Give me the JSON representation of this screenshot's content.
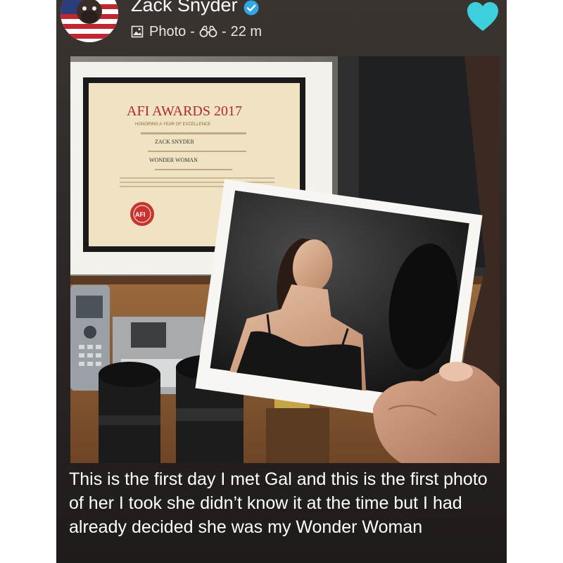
{
  "post": {
    "author": "Zack Snyder",
    "type_label": "Photo",
    "separator": "-",
    "time_ago": "22 m"
  },
  "photo": {
    "certificate_title": "AFI AWARDS 2017",
    "certificate_subtitle": "HONORING A YEAR OF EXCELLENCE",
    "certificate_name": "ZACK SNYDER",
    "certificate_film": "WONDER WOMAN",
    "seal_text": "AFI"
  },
  "caption": "This is the first day I met Gal and this is the first photo of her I took she didn’t know it at the time but I had already decided she was my Wonder Woman",
  "colors": {
    "accent_heart": "#3ecfdc",
    "verified_badge": "#2fa7e6",
    "background": "#2b2624"
  }
}
